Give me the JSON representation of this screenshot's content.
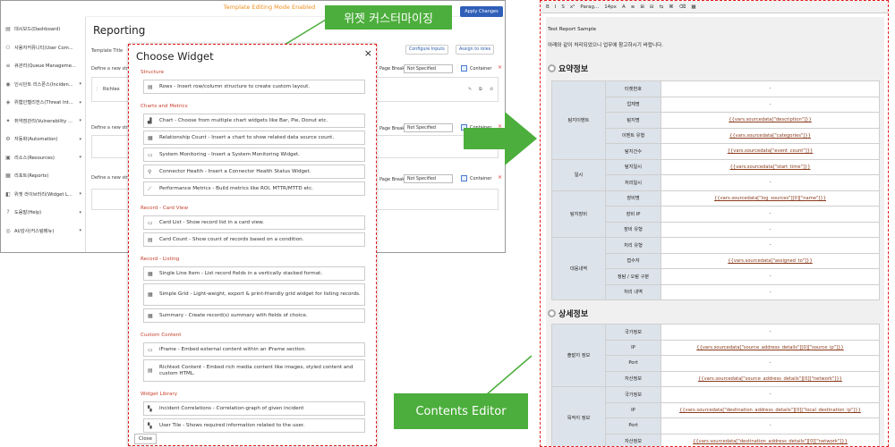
{
  "left_app": {
    "mode_text": "Template Editing Mode Enabled",
    "apply_button": "Apply Changes",
    "page_title": "Reporting",
    "template_title_label": "Template Title",
    "configure_inputs": "Configure Inputs",
    "assign_roles": "Assign to roles",
    "row_label": "Define a new struct",
    "richtext_label": "Richtex",
    "page_break_label": "Page Break",
    "select_value": "Not Specified",
    "container_label": "Container",
    "sidebar": [
      {
        "icon": "dashboard-icon",
        "glyph": "▤",
        "label": "대시보드(Dashboard)",
        "arrow": ""
      },
      {
        "icon": "user-icon",
        "glyph": "⚇",
        "label": "사용자커뮤니티(User Com...",
        "arrow": ""
      },
      {
        "icon": "queue-icon",
        "glyph": "≡",
        "label": "큐관리(Queue Manageme...",
        "arrow": ""
      },
      {
        "icon": "incident-icon",
        "glyph": "◉",
        "label": "인시던트 리스폰스(Inciden...",
        "arrow": "▾"
      },
      {
        "icon": "threat-icon",
        "glyph": "◈",
        "label": "위협인텔리전스(Threat Int...",
        "arrow": "▾"
      },
      {
        "icon": "vulnerability-icon",
        "glyph": "✦",
        "label": "취약점관리(Vulnerability ...",
        "arrow": "▾"
      },
      {
        "icon": "automation-icon",
        "glyph": "⚙",
        "label": "자동화(Automation)",
        "arrow": "▾"
      },
      {
        "icon": "resources-icon",
        "glyph": "▣",
        "label": "리소스(Resources)",
        "arrow": "▾"
      },
      {
        "icon": "reports-icon",
        "glyph": "▦",
        "label": "리포트(Reports)",
        "arrow": ""
      },
      {
        "icon": "widget-icon",
        "glyph": "◧",
        "label": "위젯 라이브러리(Widget L...",
        "arrow": "▾"
      },
      {
        "icon": "help-icon",
        "glyph": "?",
        "label": "도움말(Help)",
        "arrow": "▾"
      },
      {
        "icon": "audit-icon",
        "glyph": "◎",
        "label": "AI/감사(커스텀메뉴)",
        "arrow": "▾"
      }
    ]
  },
  "modal": {
    "title": "Choose Widget",
    "close_icon": "×",
    "close_button": "Close",
    "sections": [
      {
        "name": "Structure",
        "items": [
          {
            "icon": "rows-icon",
            "glyph": "▤",
            "text": "Rows - Insert row/column structure to create custom layout."
          }
        ]
      },
      {
        "name": "Charts and Metrics",
        "items": [
          {
            "icon": "chart-icon",
            "glyph": "▟",
            "text": "Chart - Choose from multiple chart widgets like Bar, Pie, Donut etc."
          },
          {
            "icon": "relationship-icon",
            "glyph": "▦",
            "text": "Relationship Count - Insert a chart to show related data source count."
          },
          {
            "icon": "monitor-icon",
            "glyph": "▭",
            "text": "System Monitoring - Insert a System Monitoring Widget."
          },
          {
            "icon": "connector-icon",
            "glyph": "⚲",
            "text": "Connector Health - Insert a Connector Health Status Widget."
          },
          {
            "icon": "metrics-icon",
            "glyph": "⟋",
            "text": "Performance Metrics - Build metrics like ROI, MTTR/MTTD etc."
          }
        ]
      },
      {
        "name": "Record - Card View",
        "items": [
          {
            "icon": "card-list-icon",
            "glyph": "▭",
            "text": "Card List - Show record list in a card view."
          },
          {
            "icon": "card-count-icon",
            "glyph": "▤",
            "text": "Card Count - Show count of records based on a condition."
          }
        ]
      },
      {
        "name": "Record - Listing",
        "items": [
          {
            "icon": "single-line-icon",
            "glyph": "▦",
            "text": "Single Line Item - List record fields in a vertically stacked format."
          },
          {
            "icon": "grid-icon",
            "glyph": "▦",
            "text": "Simple Grid - Light-weight, export & print-friendly grid widget for listing records.",
            "tall": true
          },
          {
            "icon": "summary-icon",
            "glyph": "▦",
            "text": "Summary - Create record(s) summary with fields of choice."
          }
        ]
      },
      {
        "name": "Custom Content",
        "items": [
          {
            "icon": "iframe-icon",
            "glyph": "▭",
            "text": "iFrame - Embed external content within an iFrame section."
          },
          {
            "icon": "richtext-icon",
            "glyph": "▤",
            "text": "Richtext Content - Embed rich media content like images, styled content and custom HTML.",
            "tall": true
          }
        ]
      },
      {
        "name": "Widget Library",
        "items": [
          {
            "icon": "correlations-icon",
            "glyph": "▚",
            "text": "Incident Correlations - Correlation-graph of given incident"
          },
          {
            "icon": "user-tile-icon",
            "glyph": "▚",
            "text": "User Tile - Shows required information related to the user."
          }
        ]
      }
    ]
  },
  "labels": {
    "widget_custom": "위젯 커스터마이징",
    "contents_editor": "Contents Editor"
  },
  "editor": {
    "toolbar": [
      "B",
      "I",
      "S",
      "x²",
      "Parag...",
      "14px",
      "A",
      "≡",
      "⊞",
      "⊟",
      "⇆",
      "⌘",
      "⌫",
      "▦"
    ],
    "doc_title": "Test Report Sample",
    "doc_subtitle": "아래와 같이 처리되었으니 업무에 참고하시기 바랍니다.",
    "section1": "요약정보",
    "section2": "상세정보",
    "summary_rows": [
      {
        "group": "탐지이벤트",
        "label": "티켓번호",
        "value": "-"
      },
      {
        "group": "",
        "label": "업체명",
        "value": "-"
      },
      {
        "group": "",
        "label": "탐지명",
        "value": "{{vars.sourcedata[\"description\"]}}"
      },
      {
        "group": "",
        "label": "이벤트 유형",
        "value": "{{vars.sourcedata[\"categories\"]}}"
      },
      {
        "group": "",
        "label": "탐지건수",
        "value": "{{vars.sourcedata[\"event_count\"]}}"
      },
      {
        "group": "일시",
        "label": "탐지일시",
        "value": "{{vars.sourcedata[\"start_time\"]}}"
      },
      {
        "group": "",
        "label": "처리일시",
        "value": "-"
      },
      {
        "group": "탐지장비",
        "label": "장비명",
        "value": "{{vars.sourcedata[\"log_sources\"][0][\"name\"]}}"
      },
      {
        "group": "",
        "label": "장비 IP",
        "value": "-"
      },
      {
        "group": "",
        "label": "장비 유형",
        "value": "-"
      },
      {
        "group": "대응내역",
        "label": "처리 유형",
        "value": "-"
      },
      {
        "group": "",
        "label": "접수자",
        "value": "{{vars.sourcedata[\"assigned_to\"]}}"
      },
      {
        "group": "",
        "label": "정탐 / 오탐 구분",
        "value": "-"
      },
      {
        "group": "",
        "label": "처리 내역",
        "value": "-"
      }
    ],
    "detail_rows": [
      {
        "group": "출발지 정보",
        "label": "국가정보",
        "value": "-"
      },
      {
        "group": "",
        "label": "IP",
        "value": "{{vars.sourcedata[\"source_address_details\"][0][\"source_ip\"]}}"
      },
      {
        "group": "",
        "label": "Port",
        "value": "-"
      },
      {
        "group": "",
        "label": "자산정보",
        "value": "{{vars.sourcedata[\"source_address_details\"][0][\"network\"]}}"
      },
      {
        "group": "목적지 정보",
        "label": "국가정보",
        "value": "-"
      },
      {
        "group": "",
        "label": "IP",
        "value": "{{vars.sourcedata[\"destination_address_details\"][0][\"local_destination_ip\"]}}"
      },
      {
        "group": "",
        "label": "Port",
        "value": "-"
      },
      {
        "group": "",
        "label": "자산정보",
        "value": "{{vars.sourcedata[\"destination_address_details\"][0][\"network\"]}}"
      }
    ]
  },
  "colors": {
    "accent_green": "#4cae3c",
    "highlight_red": "#e21b1b",
    "apply_blue": "#2f5fb8",
    "mode_orange": "#f08c1e"
  }
}
